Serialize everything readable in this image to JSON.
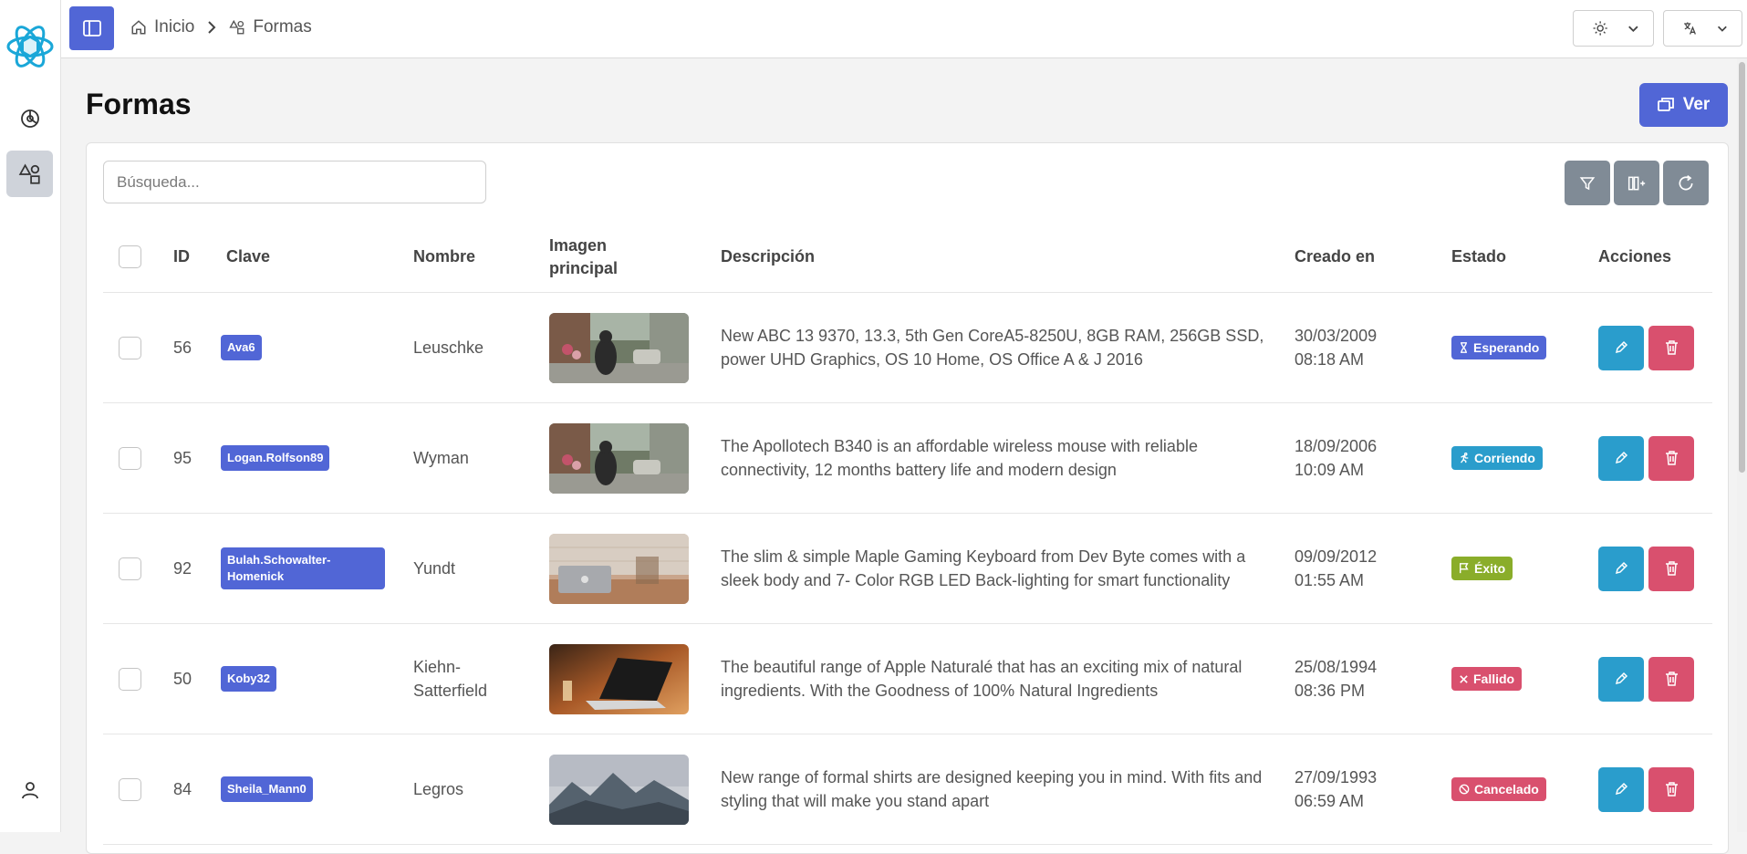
{
  "breadcrumb": {
    "home": "Inicio",
    "current": "Formas"
  },
  "page": {
    "title": "Formas",
    "view_button": "Ver"
  },
  "search": {
    "placeholder": "Búsqueda..."
  },
  "columns": {
    "id": "ID",
    "clave": "Clave",
    "nombre": "Nombre",
    "imagen_l1": "Imagen",
    "imagen_l2": "principal",
    "descripcion": "Descripción",
    "creado": "Creado en",
    "estado": "Estado",
    "acciones": "Acciones"
  },
  "rows": [
    {
      "id": "56",
      "clave": "Ava6",
      "nombre": "Leuschke",
      "image": "street-photo",
      "descripcion": "New ABC 13 9370, 13.3, 5th Gen CoreA5-8250U, 8GB RAM, 256GB SSD, power UHD Graphics, OS 10 Home, OS Office A & J 2016",
      "fecha": "30/03/2009",
      "hora": "08:18 AM",
      "estado": "Esperando",
      "estado_icon": "hourglass-icon",
      "estado_color": "#5166d6"
    },
    {
      "id": "95",
      "clave": "Logan.Rolfson89",
      "nombre": "Wyman",
      "image": "street-photo",
      "descripcion": "The Apollotech B340 is an affordable wireless mouse with reliable connectivity, 12 months battery life and modern design",
      "fecha": "18/09/2006",
      "hora": "10:09 AM",
      "estado": "Corriendo",
      "estado_icon": "running-icon",
      "estado_color": "#2a9dcc"
    },
    {
      "id": "92",
      "clave": "Bulah.Schowalter-Homenick",
      "nombre": "Yundt",
      "image": "laptop-desk-photo",
      "descripcion": "The slim & simple Maple Gaming Keyboard from Dev Byte comes with a sleek body and 7- Color RGB LED Back-lighting for smart functionality",
      "fecha": "09/09/2012",
      "hora": "01:55 AM",
      "estado": "Éxito",
      "estado_icon": "flag-icon",
      "estado_color": "#8aad2a"
    },
    {
      "id": "50",
      "clave": "Koby32",
      "nombre": "Kiehn-Satterfield",
      "image": "laptop-table-photo",
      "descripcion": "The beautiful range of Apple Naturalé that has an exciting mix of natural ingredients. With the Goodness of 100% Natural Ingredients",
      "fecha": "25/08/1994",
      "hora": "08:36 PM",
      "estado": "Fallido",
      "estado_icon": "x-icon",
      "estado_color": "#d9506e"
    },
    {
      "id": "84",
      "clave": "Sheila_Mann0",
      "nombre": "Legros",
      "image": "mountain-photo",
      "descripcion": "New range of formal shirts are designed keeping you in mind. With fits and styling that will make you stand apart",
      "fecha": "27/09/1993",
      "hora": "06:59 AM",
      "estado": "Cancelado",
      "estado_icon": "ban-icon",
      "estado_color": "#d9506e"
    }
  ],
  "colors": {
    "primary": "#5166d6",
    "edit": "#2a9dcc",
    "delete": "#d9506e",
    "tool": "#808b96"
  }
}
